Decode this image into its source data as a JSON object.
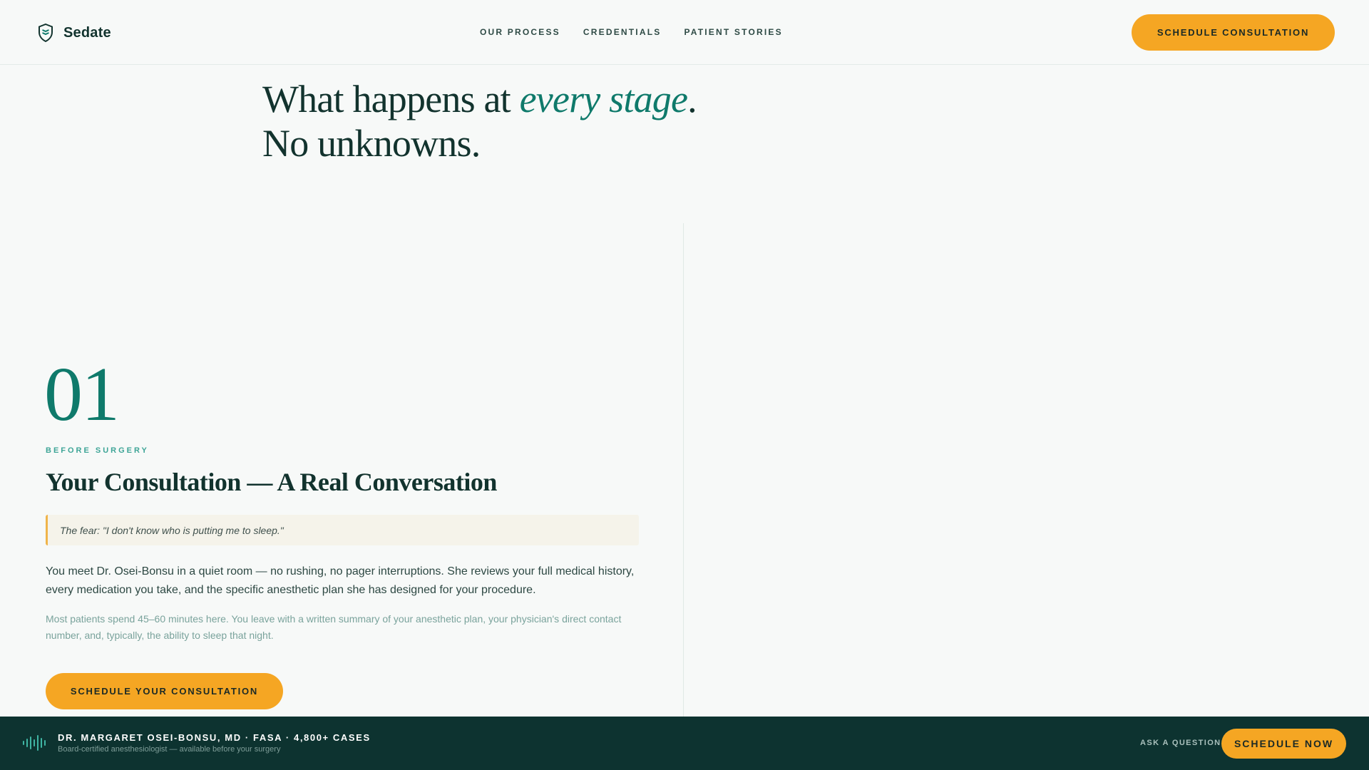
{
  "brand": {
    "name": "Sedate",
    "logo_icon": "shield-icon"
  },
  "nav": {
    "items": [
      {
        "label": "Our Process"
      },
      {
        "label": "Credentials"
      },
      {
        "label": "Patient Stories"
      }
    ],
    "cta_label": "Schedule Consultation"
  },
  "hero": {
    "line1_prefix": "What happens at ",
    "line1_emphasis": "every stage",
    "line1_suffix": ".",
    "line2": "No unknowns."
  },
  "stage": {
    "number": "01",
    "eyebrow": "Before Surgery",
    "title": "Your Consultation — A Real Conversation",
    "fear": "The fear: \"I don't know who is putting me to sleep.\"",
    "body": "You meet Dr. Osei-Bonsu in a quiet room — no rushing, no pager interruptions. She reviews your full medical history, every medication you take, and the specific anesthetic plan she has designed for your procedure.",
    "note": "Most patients spend 45–60 minutes here. You leave with a written summary of your anesthetic plan, your physician's direct contact number, and, typically, the ability to sleep that night.",
    "cta_label": "Schedule Your Consultation"
  },
  "footer": {
    "wave_icon": "sound-wave-icon",
    "doctor_name": "Dr. Margaret Osei-Bonsu, MD · FASA · 4,800+ Cases",
    "doctor_sub": "Board-certified anesthesiologist — available before your surgery",
    "ask_label": "Ask a Question",
    "cta_label": "Schedule Now"
  },
  "colors": {
    "accent": "#0f7a6b",
    "cta": "#f5a623",
    "footer_bg": "#0d3330",
    "background": "#f7f9f8"
  }
}
